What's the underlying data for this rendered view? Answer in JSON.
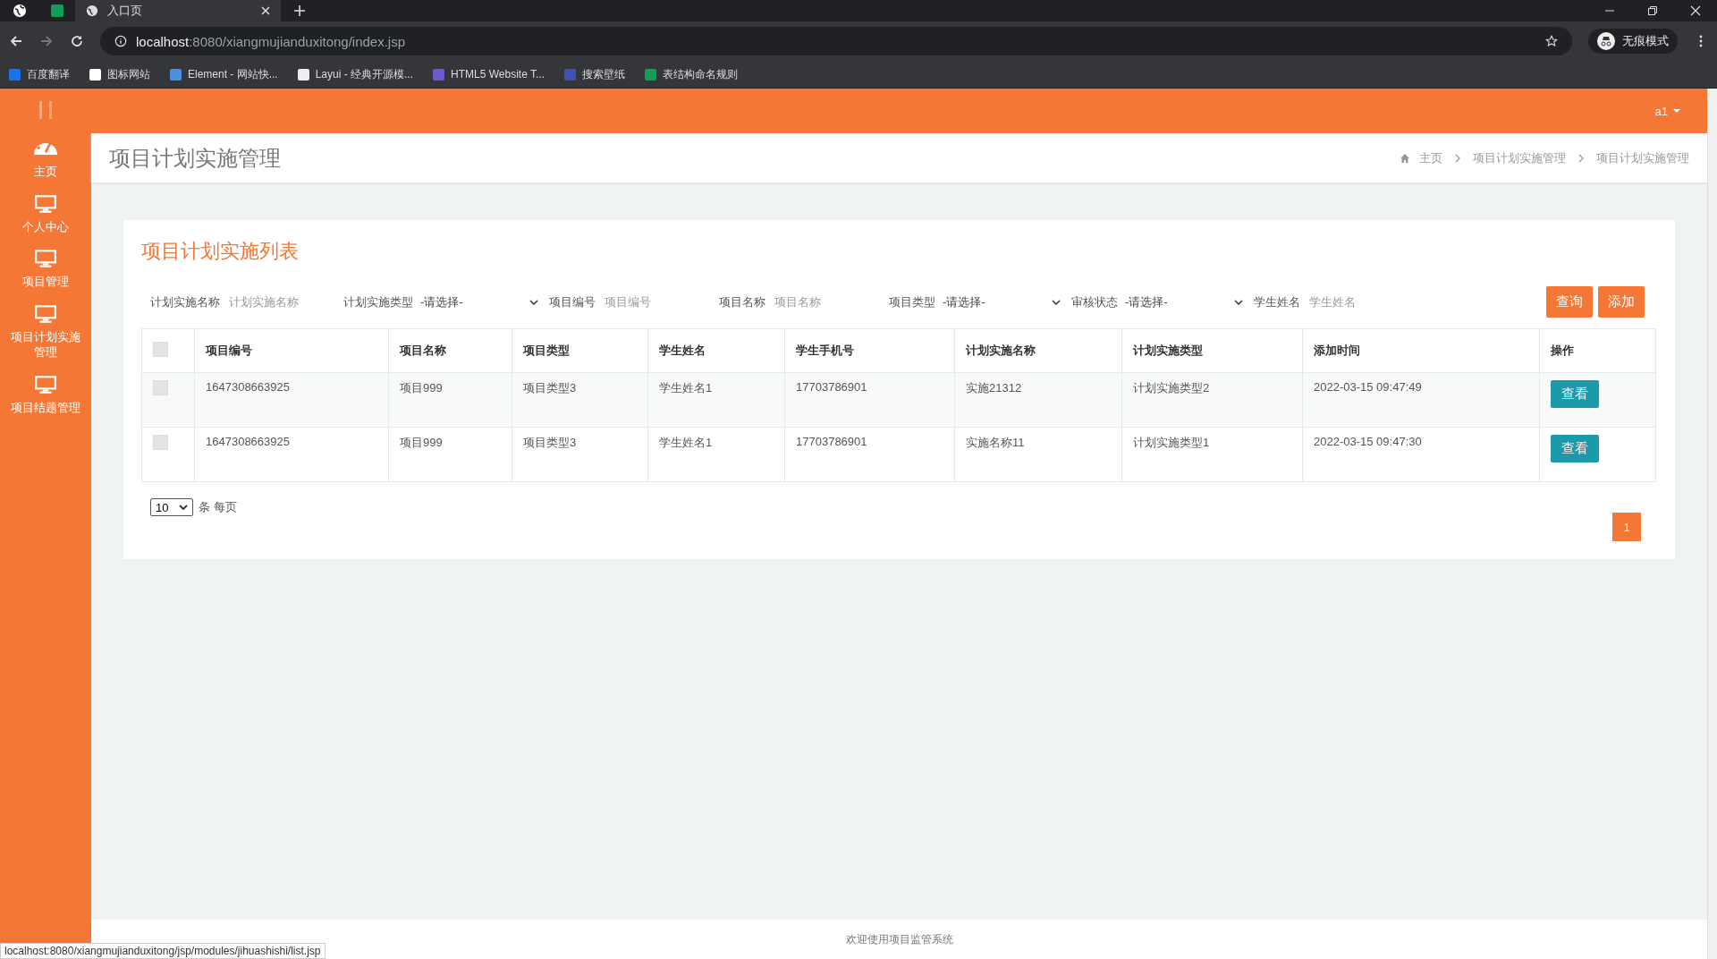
{
  "browser": {
    "tabs": [
      {
        "title": "入口页",
        "selected": true
      }
    ],
    "address": {
      "host": "localhost",
      "rest": ":8080/xiangmujianduxitong/index.jsp"
    },
    "bookmarks": [
      "百度翻译",
      "图标网站",
      "Element - 网站快...",
      "Layui - 经典开源模...",
      "HTML5 Website T...",
      "搜索壁纸",
      "表结构命名规则"
    ],
    "profile": "无痕模式"
  },
  "header": {
    "user": "a1"
  },
  "sidebar": {
    "items": [
      {
        "label": "主页",
        "kind": "dashboard"
      },
      {
        "label": "个人中心",
        "kind": "monitor"
      },
      {
        "label": "项目管理",
        "kind": "monitor"
      },
      {
        "label": "项目计划实施管理",
        "kind": "monitor"
      },
      {
        "label": "项目结题管理",
        "kind": "monitor"
      }
    ]
  },
  "page_title": "项目计划实施管理",
  "breadcrumb": [
    "主页",
    "项目计划实施管理",
    "项目计划实施管理"
  ],
  "card_title": "项目计划实施列表",
  "filters": [
    {
      "kind": "text",
      "label": "计划实施名称",
      "placeholder": "计划实施名称"
    },
    {
      "kind": "select",
      "label": "计划实施类型",
      "value": "-请选择-"
    },
    {
      "kind": "text",
      "label": "项目编号",
      "placeholder": "项目编号"
    },
    {
      "kind": "text",
      "label": "项目名称",
      "placeholder": "项目名称"
    },
    {
      "kind": "select",
      "label": "项目类型",
      "value": "-请选择-"
    },
    {
      "kind": "select",
      "label": "审核状态",
      "value": "-请选择-"
    },
    {
      "kind": "text",
      "label": "学生姓名",
      "placeholder": "学生姓名"
    }
  ],
  "buttons": [
    "查询",
    "添加"
  ],
  "table": {
    "all_checked": false,
    "columns": [
      "项目编号",
      "项目名称",
      "项目类型",
      "学生姓名",
      "学生手机号",
      "计划实施名称",
      "计划实施类型",
      "添加时间",
      "操作"
    ],
    "rows": [
      {
        "checked": false,
        "cells": [
          "1647308663925",
          "项目999",
          "项目类型3",
          "学生姓名1",
          "17703786901",
          "实施21312",
          "计划实施类型2",
          "2022-03-15 09:47:49"
        ],
        "action": "查看"
      },
      {
        "checked": false,
        "cells": [
          "1647308663925",
          "项目999",
          "项目类型3",
          "学生姓名1",
          "17703786901",
          "实施名称11",
          "计划实施类型1",
          "2022-03-15 09:47:30"
        ],
        "action": "查看"
      }
    ]
  },
  "page_size": "10",
  "page_size_label": "条 每页",
  "pagination": [
    {
      "label": "1",
      "selected": true
    }
  ],
  "footer": "欢迎使用项目监管系统",
  "status_url": "localhost:8080/xiangmujianduxitong/jsp/modules/jihuashishi/list.jsp"
}
